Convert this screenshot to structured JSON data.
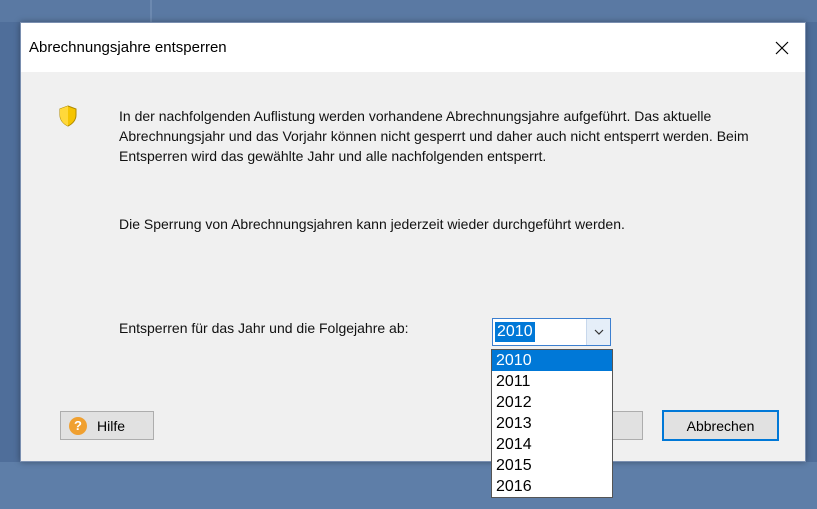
{
  "dialog": {
    "title": "Abrechnungsjahre entsperren",
    "close_icon": "close-icon"
  },
  "info": {
    "icon": "shield-icon",
    "paragraph1": "In der nachfolgenden Auflistung werden vorhandene Abrechnungsjahre aufgeführt. Das aktuelle Abrechnungsjahr und das Vorjahr können nicht gesperrt und daher auch nicht entsperrt werden. Beim Entsperren wird das gewählte Jahr und alle nachfolgenden entsperrt.",
    "paragraph2": "Die Sperrung von Abrechnungsjahren kann jederzeit wieder durchgeführt werden."
  },
  "year_select": {
    "label": "Entsperren für das Jahr und die Folgejahre ab:",
    "value": "2010",
    "options": [
      "2010",
      "2011",
      "2012",
      "2013",
      "2014",
      "2015",
      "2016"
    ]
  },
  "buttons": {
    "help_label": "Hilfe",
    "help_icon": "?",
    "cancel_label": "Abbrechen"
  },
  "colors": {
    "accent": "#0078d7",
    "shield": "#f5c400",
    "help": "#f0a030"
  }
}
